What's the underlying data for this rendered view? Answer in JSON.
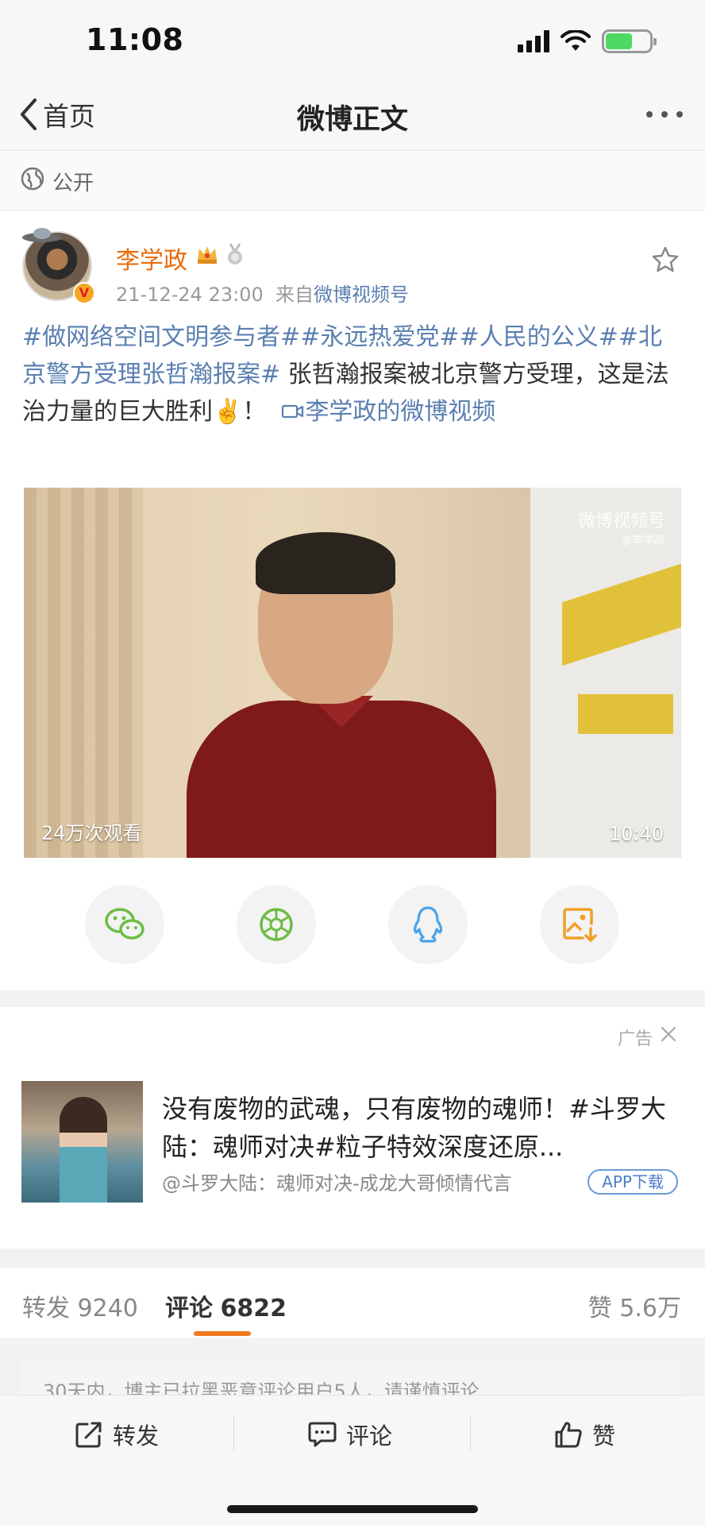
{
  "status_bar": {
    "time": "11:08"
  },
  "nav": {
    "back_label": "首页",
    "title": "微博正文"
  },
  "visibility": {
    "label": "公开"
  },
  "post": {
    "author": "李学政",
    "timestamp": "21-12-24 23:00",
    "source_prefix": "来自",
    "source": "微博视频号",
    "tags": [
      "#做网络空间文明参与者#",
      "#永远热爱党#",
      "#人民的公义#",
      "#北京警方受理张哲瀚报案#"
    ],
    "text_body": " 张哲瀚报案被北京警方受理，这是法治力量的巨大胜利✌️！",
    "video_link_label": "李学政的微博视频",
    "video": {
      "watermark": "微博视频号",
      "watermark_sub": "@李学政",
      "views": "24万次观看",
      "duration": "10:40"
    }
  },
  "share_icons": [
    "wechat-icon",
    "moments-icon",
    "qq-icon",
    "save-image-icon"
  ],
  "ad": {
    "label": "广告",
    "title": "没有废物的武魂，只有废物的魂师！#斗罗大陆：魂师对决#粒子特效深度还原...",
    "source": "@斗罗大陆：魂师对决-成龙大哥倾情代言",
    "button": "APP下载"
  },
  "tabs": {
    "repost_label": "转发",
    "repost_count": "9240",
    "comment_label": "评论",
    "comment_count": "6822",
    "like_label": "赞",
    "like_count": "5.6万"
  },
  "notice": "30天内，博主已拉黑恶意评论用户5人，请谨慎评论",
  "bottom_bar": {
    "repost": "转发",
    "comment": "评论",
    "like": "赞"
  },
  "colors": {
    "accent_orange": "#f27a21",
    "link_blue": "#5a7fb0",
    "username_orange": "#e86b0a"
  }
}
